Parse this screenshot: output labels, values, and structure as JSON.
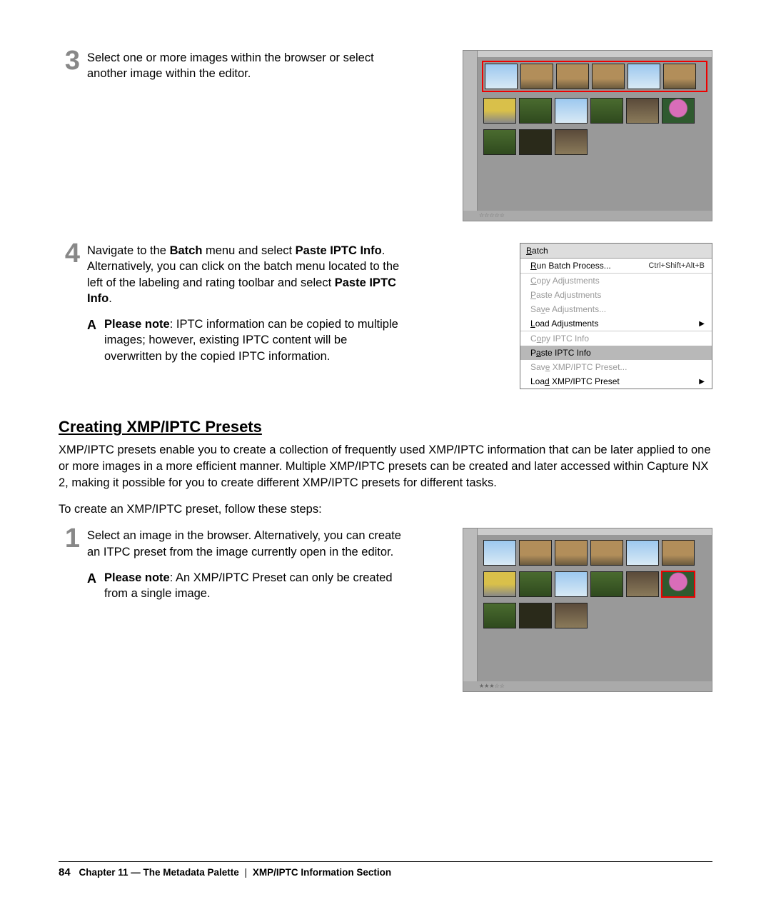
{
  "steps": {
    "three": {
      "num": "3",
      "text": "Select one or more images within the browser or select another image within the editor."
    },
    "four": {
      "num": "4",
      "text_pre": "Navigate to the ",
      "bold1": "Batch",
      "text_mid1": " menu and select ",
      "bold2": "Paste IPTC Info",
      "text_mid2": ". Alternatively, you can click on the batch menu located to the left of the labeling and rating toolbar and select ",
      "bold3": "Paste IPTC Info",
      "text_end": ".",
      "note_mark": "A",
      "note_label": "Please note",
      "note_text": ": IPTC information can be copied to multiple images; however, existing IPTC content will be overwritten by the copied IPTC information."
    },
    "one": {
      "num": "1",
      "text": "Select an image in the browser. Alternatively, you can create an ITPC preset from the image currently open in the editor.",
      "note_mark": "A",
      "note_label": "Please note",
      "note_text": ": An XMP/IPTC Preset can only be created from a single image."
    }
  },
  "menu": {
    "title": "Batch",
    "title_u": "B",
    "items": [
      {
        "pre": "",
        "u": "R",
        "post": "un Batch Process...",
        "shortcut": "Ctrl+Shift+Alt+B",
        "disabled": false,
        "arrow": false
      },
      {
        "sep": true
      },
      {
        "pre": "",
        "u": "C",
        "post": "opy Adjustments",
        "disabled": true
      },
      {
        "pre": "",
        "u": "P",
        "post": "aste Adjustments",
        "disabled": true
      },
      {
        "pre": "Sa",
        "u": "v",
        "post": "e Adjustments...",
        "disabled": true
      },
      {
        "pre": "",
        "u": "L",
        "post": "oad Adjustments",
        "disabled": false,
        "arrow": true
      },
      {
        "sep": true
      },
      {
        "pre": "C",
        "u": "o",
        "post": "py IPTC Info",
        "disabled": true
      },
      {
        "pre": "P",
        "u": "a",
        "post": "ste IPTC Info",
        "disabled": false,
        "highlight": true
      },
      {
        "pre": "Sav",
        "u": "e",
        "post": " XMP/IPTC Preset...",
        "disabled": true
      },
      {
        "pre": "Loa",
        "u": "d",
        "post": " XMP/IPTC Preset",
        "disabled": false,
        "arrow": true
      }
    ]
  },
  "section": {
    "heading": "Creating XMP/IPTC Presets",
    "para1": "XMP/IPTC presets enable you to create a collection of frequently used XMP/IPTC information that can be later applied to one or more images in a more efficient manner. Multiple XMP/IPTC presets can be created and later accessed within Capture NX 2, making it possible for you to create different XMP/IPTC presets for different tasks.",
    "para2": "To create an XMP/IPTC preset, follow these steps:"
  },
  "footer": {
    "page": "84",
    "chapter_label": "Chapter 11 — The Metadata Palette",
    "section_label": "XMP/IPTC Information Section"
  },
  "stars": "★★★☆☆"
}
